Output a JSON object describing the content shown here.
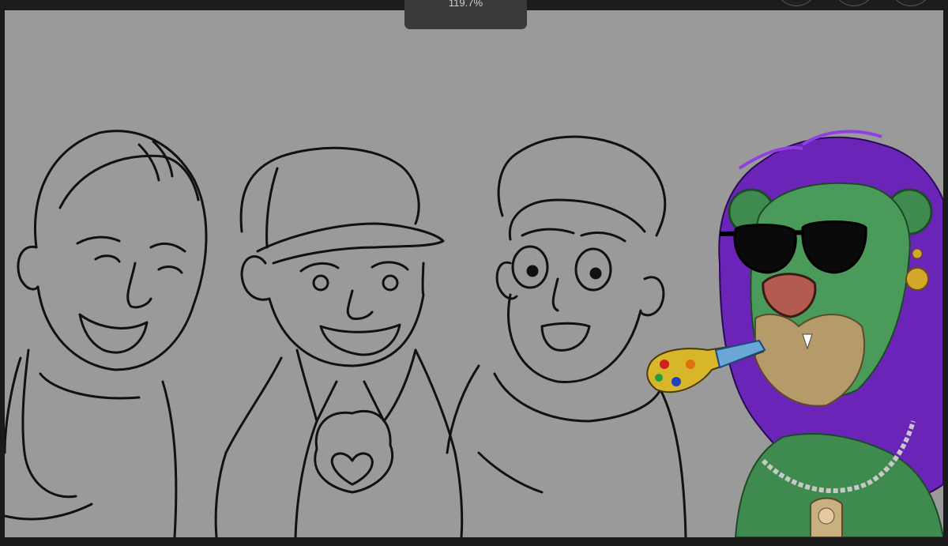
{
  "toolbar": {
    "zoom_label": "119.7%"
  },
  "colors": {
    "canvas_bg": "#9a9a9a",
    "chrome_bg": "#1a1a1a",
    "lion_fur": "#3f8a4f",
    "lion_mane": "#6a24b8"
  },
  "icons": [
    "circle-button",
    "circle-button",
    "circle-button"
  ]
}
